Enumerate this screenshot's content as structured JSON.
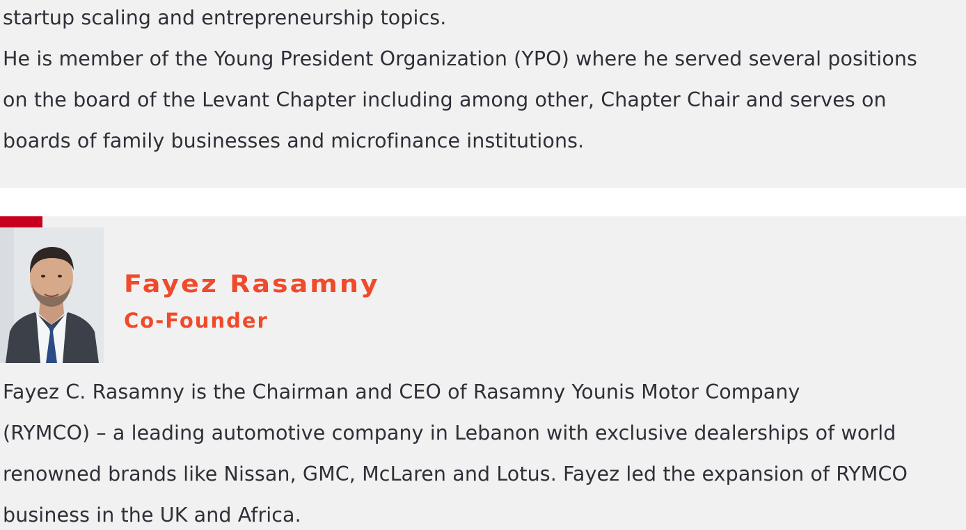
{
  "previous_member": {
    "bio_lines": [
      "startup scaling and entrepreneurship topics.",
      "He is member of the Young President Organization (YPO) where he served several positions",
      "on the board of the Levant Chapter including among other, Chapter Chair and serves on",
      "boards of family businesses and microfinance institutions."
    ]
  },
  "member": {
    "name": "Fayez Rasamny",
    "role": "Co-Founder",
    "bio_lines": [
      "Fayez C. Rasamny is the Chairman and CEO of Rasamny Younis Motor Company",
      "(RYMCO) – a leading automotive company in Lebanon with exclusive dealerships of world",
      "renowned brands like Nissan, GMC, McLaren and Lotus. Fayez led the expansion of RYMCO",
      "business in the UK and Africa."
    ]
  },
  "colors": {
    "accent_red": "#c8001f",
    "title_orange": "#ef4a2b",
    "panel_bg": "#f1f1f1",
    "text": "#2f2f38"
  }
}
